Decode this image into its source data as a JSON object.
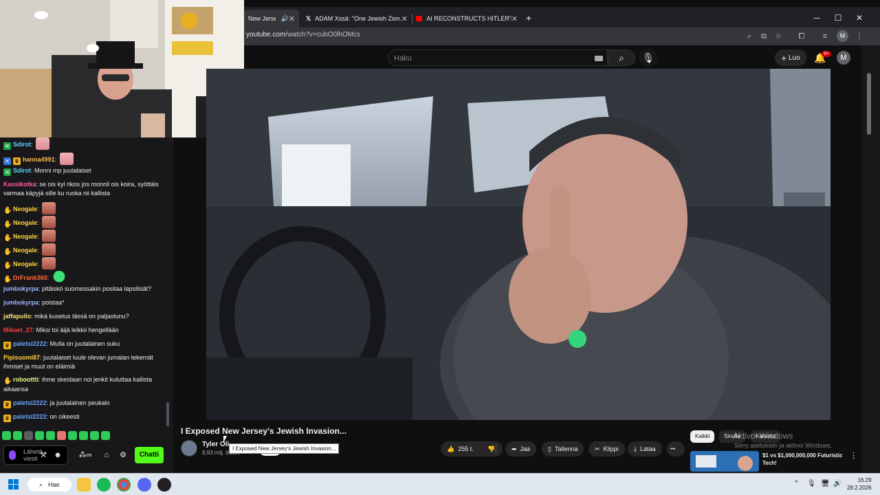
{
  "browser": {
    "tabs": [
      {
        "label": "New Jersey",
        "active": true
      },
      {
        "label": "ADAM Xssä: \"One Jewish Zion…"
      },
      {
        "label": "AI RECONSTRUCTS HITLER'S S…"
      }
    ],
    "url_host": "youtube.com",
    "url_path": "/watch?v=cubO0lhOMcs",
    "profile_initial": "M",
    "new_tab_glyph": "+",
    "close_glyph": "✕",
    "minimize_glyph": "─",
    "maximize_glyph": "☐"
  },
  "youtube": {
    "search_placeholder": "Haku",
    "create_label": "Luo",
    "notifications_badge": "9+",
    "account_initial": "M",
    "video_title": "I Exposed New Jersey's Jewish Invasion...",
    "channel_name": "Tyler Oli",
    "subscriber_count": "8,93 milj. tilaa...",
    "hover_tooltip": "I Exposed New Jersey's Jewish Invasion...",
    "like_count": "255 t.",
    "share_label": "Jaa",
    "save_label": "Tallenna",
    "clip_label": "Klippi",
    "download_label": "Lataa",
    "more_glyph": "•••",
    "chips": [
      "Kaikki",
      "Sinulle",
      "Katsotut"
    ],
    "recommended_title": "$1 vs $1,000,000,000 Futuristic Tech!"
  },
  "windows_activation": {
    "title": "Aktivoi Windows",
    "subtitle": "Siirry asetuksiin ja aktivoi Windows."
  },
  "chat": {
    "messages": [
      {
        "user": "Sdirot",
        "color": "#5bd1ff",
        "badges": [
          "sub"
        ],
        "text": "",
        "emotes": [
          "pink"
        ]
      },
      {
        "user": "hanna4991",
        "color": "#ffb84d",
        "badges": [
          "blue",
          "crown"
        ],
        "text": "",
        "emotes": [
          "pink"
        ]
      },
      {
        "user": "Sdirot",
        "color": "#5bd1ff",
        "badges": [
          "sub"
        ],
        "text": "Monni mp juutalaiset",
        "emotes": []
      },
      {
        "user": "Kassikotka",
        "color": "#ff5fa2",
        "badges": [],
        "text": "se ois kyl rikos jos monnil ois koira, syöttäis varmaa käpyjä sille ku ruoka nii kallista",
        "emotes": []
      },
      {
        "user": "Neogale",
        "color": "#ffd23f",
        "badges": [
          "hand"
        ],
        "text": "",
        "emotes": [
          "face"
        ]
      },
      {
        "user": "Neogale",
        "color": "#ffd23f",
        "badges": [
          "hand"
        ],
        "text": "",
        "emotes": [
          "face"
        ]
      },
      {
        "user": "Neogale",
        "color": "#ffd23f",
        "badges": [
          "hand"
        ],
        "text": "",
        "emotes": [
          "face"
        ]
      },
      {
        "user": "Neogale",
        "color": "#ffd23f",
        "badges": [
          "hand"
        ],
        "text": "",
        "emotes": [
          "face"
        ]
      },
      {
        "user": "Neogale",
        "color": "#ffd23f",
        "badges": [
          "hand"
        ],
        "text": "",
        "emotes": [
          "face"
        ]
      },
      {
        "user": "DrFrank360",
        "color": "#ff6a3d",
        "badges": [
          "hand"
        ],
        "text": "",
        "emotes": [
          "green"
        ]
      },
      {
        "user": "jumbokyrpa",
        "color": "#9db8ff",
        "badges": [],
        "text": "pitäiskö suomessakin positaa lapsilisät?",
        "emotes": []
      },
      {
        "user": "jumbokyrpa",
        "color": "#9db8ff",
        "badges": [],
        "text": "poistaa*",
        "emotes": []
      },
      {
        "user": "jaffapullo",
        "color": "#ffe27a",
        "badges": [],
        "text": "mikä kusetus tässä on paljastunu?",
        "emotes": []
      },
      {
        "user": "Mikael_27",
        "color": "#ff3b3b",
        "badges": [],
        "text": "Miksi toi äijä leikkii hengellään",
        "emotes": []
      },
      {
        "user": "paletsi2222",
        "color": "#6aa4ff",
        "badges": [
          "crown"
        ],
        "text": "Mulla on juutalainen suku",
        "emotes": []
      },
      {
        "user": "Pipisuomi87",
        "color": "#ffd23f",
        "badges": [],
        "text": "juutalaiset luule olevan jumalan tekemät ihmiset ja muut on eläimiä",
        "emotes": []
      },
      {
        "user": "roboottti",
        "color": "#e8ff7a",
        "badges": [
          "hand"
        ],
        "text": "ihme skeidaan noi jenkit kuluttaa kallista aikaansa",
        "emotes": []
      },
      {
        "user": "paletsi2222",
        "color": "#6aa4ff",
        "badges": [
          "crown"
        ],
        "text": "ja juutalainen peukalo",
        "emotes": []
      },
      {
        "user": "paletsi2222",
        "color": "#6aa4ff",
        "badges": [
          "crown"
        ],
        "text": "on oikeesti",
        "emotes": []
      }
    ],
    "input_placeholder": "Lähetä viesti",
    "send_label": "Chatti"
  },
  "taskbar": {
    "search_label": "Hae",
    "time": "16.29",
    "date": "28.2.2026"
  }
}
